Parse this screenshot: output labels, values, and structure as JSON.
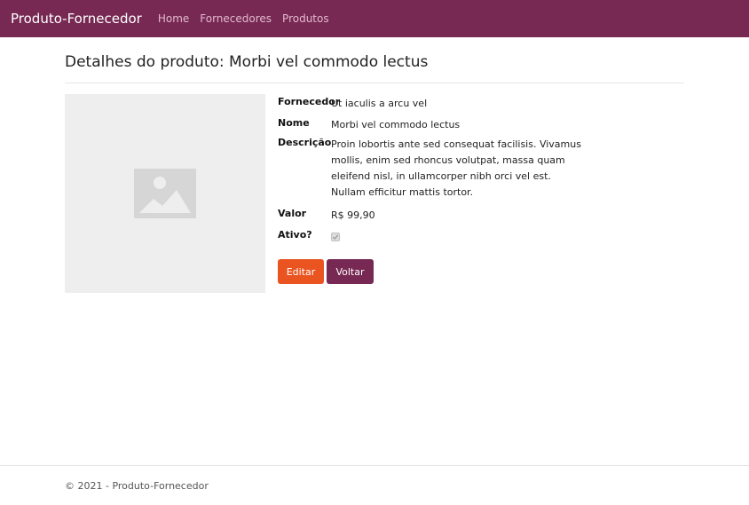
{
  "navbar": {
    "brand": "Produto-Fornecedor",
    "links": [
      "Home",
      "Fornecedores",
      "Produtos"
    ]
  },
  "page": {
    "title": "Detalhes do produto: Morbi vel commodo lectus"
  },
  "image": {
    "icon": "image-placeholder-icon"
  },
  "details": {
    "fornecedor": {
      "label": "Fornecedor",
      "value": "Ut iaculis a arcu vel"
    },
    "nome": {
      "label": "Nome",
      "value": "Morbi vel commodo lectus"
    },
    "descricao": {
      "label": "Descrição",
      "value": "Proin lobortis ante sed consequat facilisis. Vivamus mollis, enim sed rhoncus volutpat, massa quam eleifend nisl, in ullamcorper nibh orci vel est. Nullam efficitur mattis tortor."
    },
    "valor": {
      "label": "Valor",
      "value": "R$ 99,90"
    },
    "ativo": {
      "label": "Ativo?",
      "checked": true
    }
  },
  "actions": {
    "edit_label": "Editar",
    "back_label": "Voltar"
  },
  "footer": {
    "text": "© 2021 - Produto-Fornecedor"
  },
  "colors": {
    "navbar": "#772953",
    "edit_button": "#e95420",
    "back_button": "#772953",
    "image_bg": "#eeeeee"
  }
}
